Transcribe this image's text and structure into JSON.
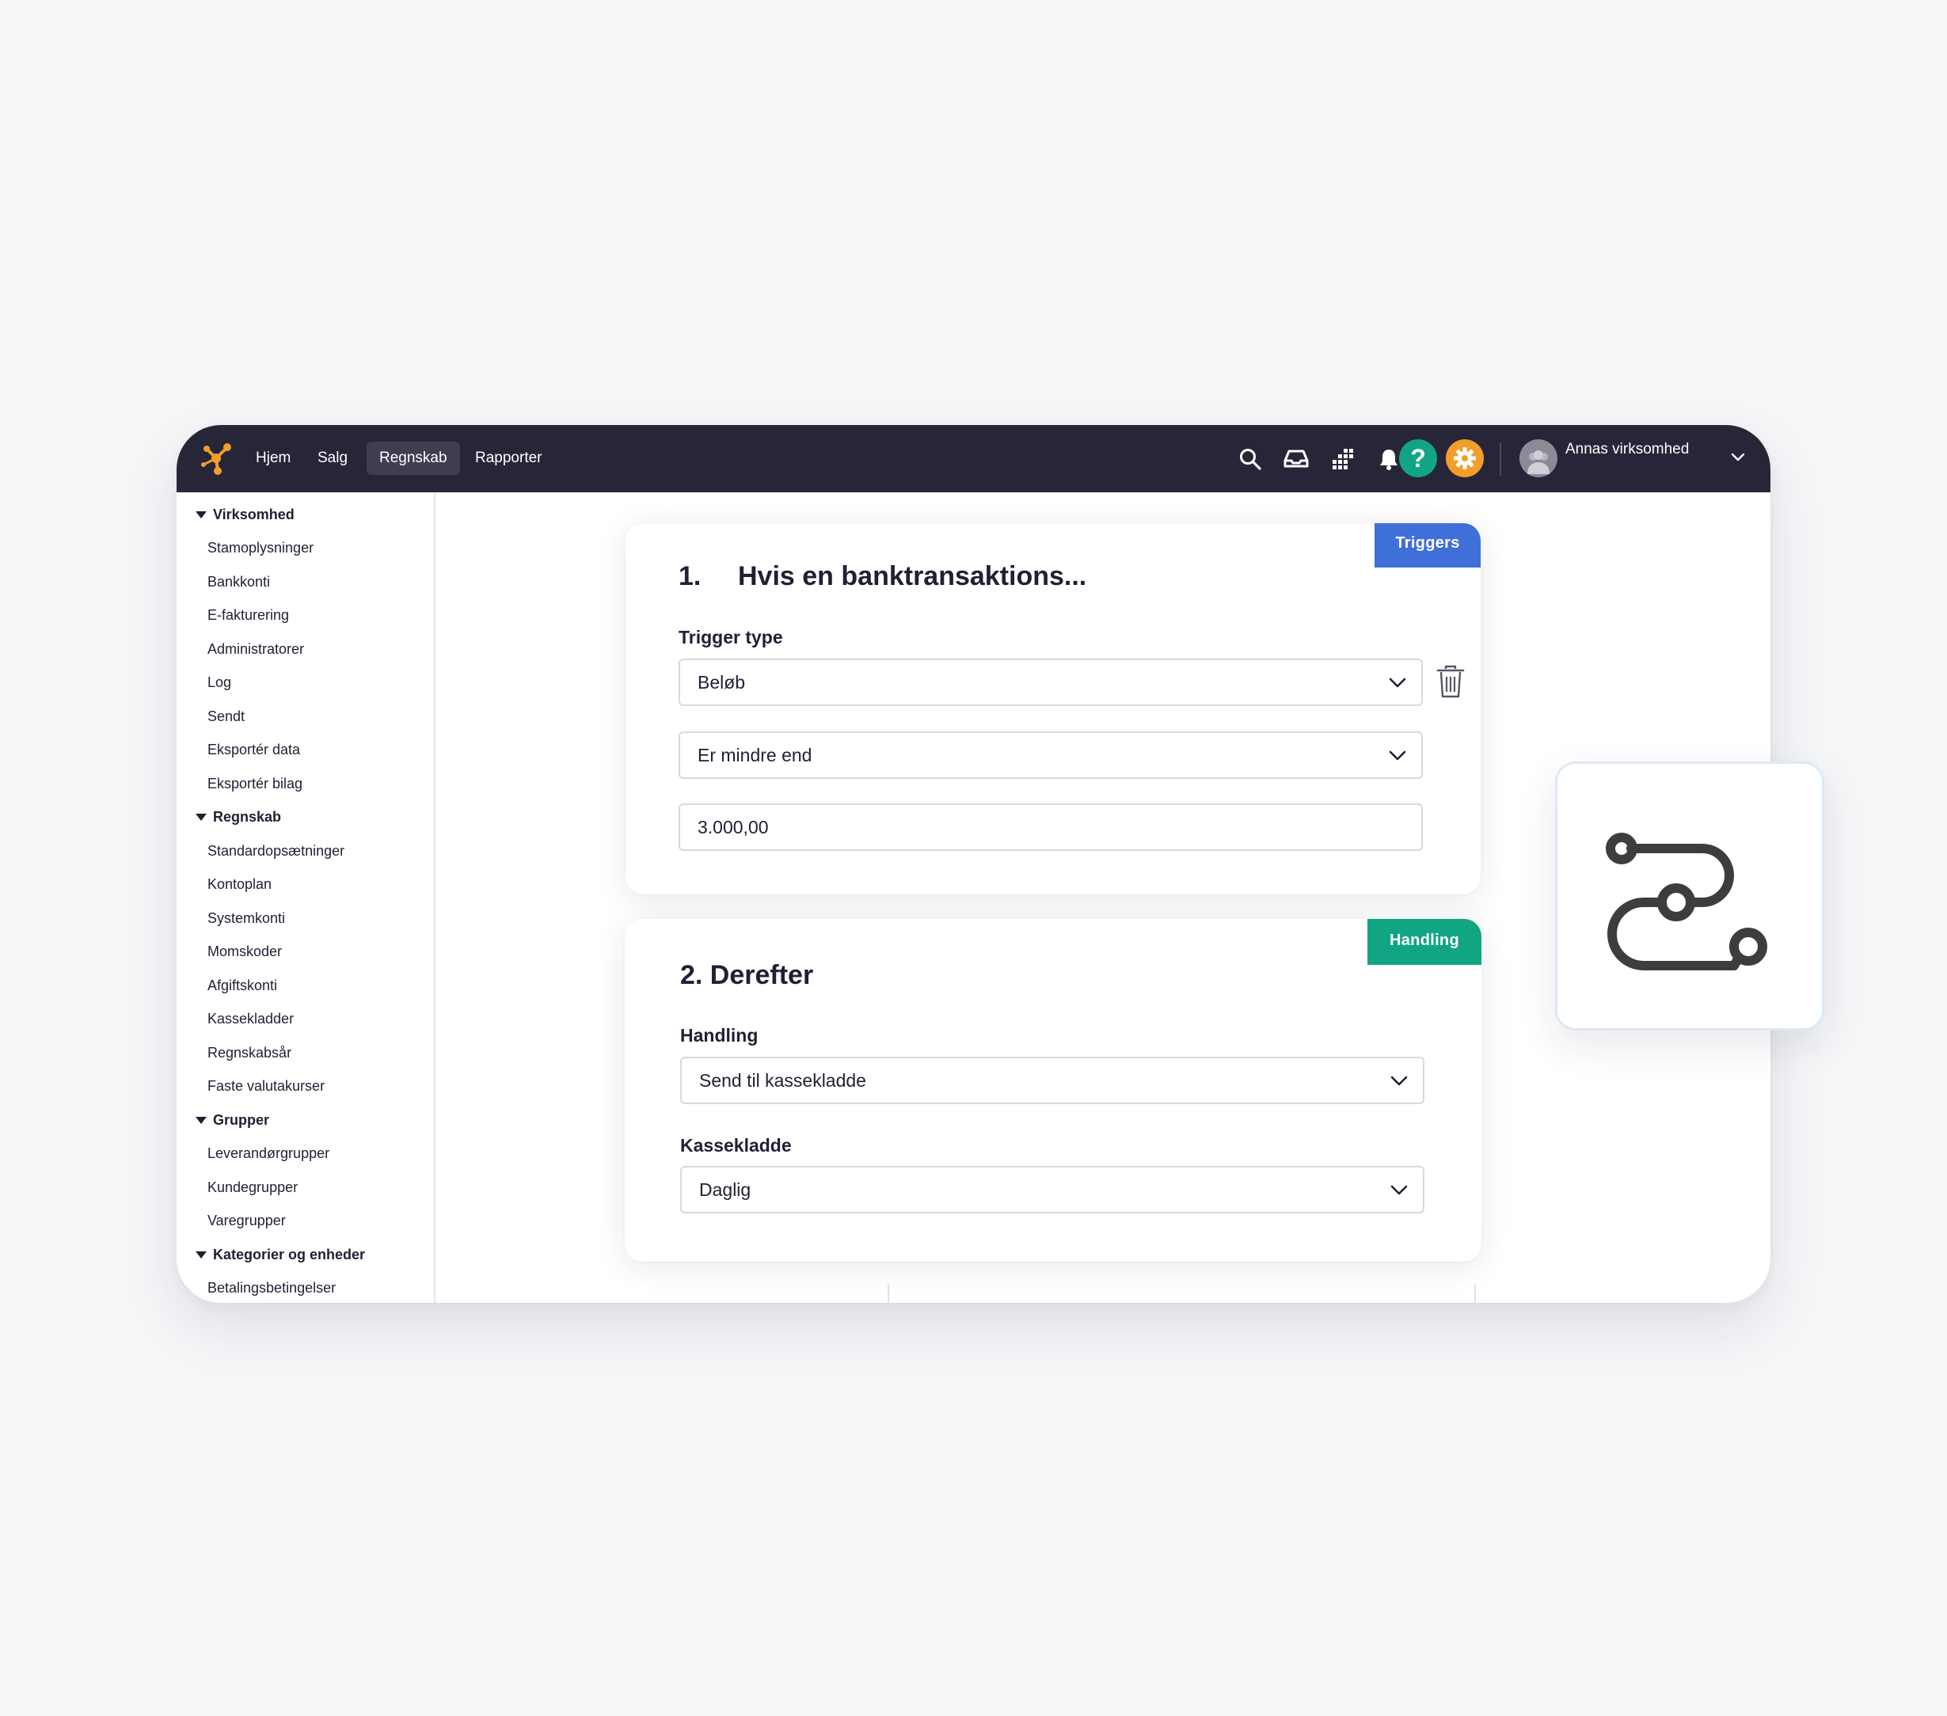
{
  "topbar": {
    "nav": [
      "Hjem",
      "Salg",
      "Regnskab",
      "Rapporter"
    ],
    "active_nav": "Regnskab",
    "icons": [
      "search-icon",
      "inbox-icon",
      "apps-grid-icon",
      "bell-icon",
      "help-icon",
      "settings-icon"
    ],
    "help_label": "?",
    "company_name": "Annas virksomhed"
  },
  "sidebar": {
    "groups": [
      {
        "label": "Virksomhed",
        "items": [
          "Stamoplysninger",
          "Bankkonti",
          "E-fakturering",
          "Administratorer",
          "Log",
          "Sendt",
          "Eksportér data",
          "Eksportér bilag"
        ]
      },
      {
        "label": "Regnskab",
        "items": [
          "Standardopsætninger",
          "Kontoplan",
          "Systemkonti",
          "Momskoder",
          "Afgiftskonti",
          "Kassekladder",
          "Regnskabsår",
          "Faste valutakurser"
        ]
      },
      {
        "label": "Grupper",
        "items": [
          "Leverandørgrupper",
          "Kundegrupper",
          "Varegrupper"
        ]
      },
      {
        "label": "Kategorier og enheder",
        "items": [
          "Betalingsbetingelser"
        ]
      }
    ]
  },
  "trigger_card": {
    "badge": "Triggers",
    "number": "1.",
    "title": "Hvis en banktransaktions...",
    "trigger_type_label": "Trigger type",
    "trigger_type_value": "Beløb",
    "condition_value": "Er mindre end",
    "amount_value": "3.000,00"
  },
  "action_card": {
    "badge": "Handling",
    "title": "2. Derefter",
    "handling_label": "Handling",
    "handling_value": "Send til kassekladde",
    "kassekladde_label": "Kassekladde",
    "kassekladde_value": "Daglig"
  },
  "colors": {
    "topbar": "#272639",
    "triggers_badge": "#3f6fd8",
    "handling_badge": "#12a583",
    "help": "#12a583",
    "settings": "#f29e2b",
    "logo": "#f29e2b"
  }
}
